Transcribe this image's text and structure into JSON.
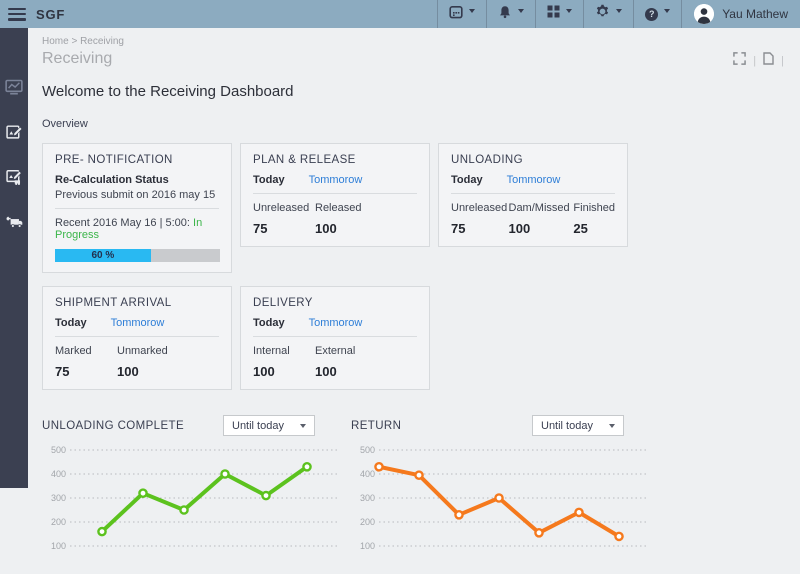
{
  "topbar": {
    "brand": "SGF",
    "user_name": "Yau Mathew",
    "icons": [
      "menu",
      "calendar",
      "notifications",
      "apps",
      "settings",
      "help",
      "user-avatar"
    ],
    "help_glyph": "?"
  },
  "page": {
    "breadcrumb": "Home > Receiving",
    "title": "Receiving",
    "welcome": "Welcome to the Receiving Dashboard",
    "section_label": "Overview"
  },
  "sidebar": {
    "items": [
      "dashboard",
      "receiving-edit",
      "receiving-dispatch-edit",
      "inbound-truck"
    ]
  },
  "cards": {
    "pre_notification": {
      "title": "PRE- NOTIFICATION",
      "status_title": "Re-Calculation Status",
      "status_sub": "Previous submit on 2016 may 15",
      "recent_label": "Recent 2016 May 16 | 5:00:",
      "recent_status": "In Progress",
      "progress_pct": 58,
      "progress_label": "60 %"
    },
    "plan_release": {
      "title": "PLAN & RELEASE",
      "tab_today": "Today",
      "tab_tomorrow": "Tommorow",
      "stats": [
        {
          "label": "Unreleased",
          "value": "75"
        },
        {
          "label": "Released",
          "value": "100"
        }
      ]
    },
    "unloading": {
      "title": "UNLOADING",
      "tab_today": "Today",
      "tab_tomorrow": "Tommorow",
      "stats": [
        {
          "label": "Unreleased",
          "value": "75"
        },
        {
          "label": "Dam/Missed",
          "value": "100"
        },
        {
          "label": "Finished",
          "value": "25"
        }
      ]
    },
    "shipment_arrival": {
      "title": "SHIPMENT ARRIVAL",
      "tab_today": "Today",
      "tab_tomorrow": "Tommorow",
      "stats": [
        {
          "label": "Marked",
          "value": "75"
        },
        {
          "label": "Unmarked",
          "value": "100"
        }
      ]
    },
    "delivery": {
      "title": "DELIVERY",
      "tab_today": "Today",
      "tab_tomorrow": "Tommorow",
      "stats": [
        {
          "label": "Internal",
          "value": "100"
        },
        {
          "label": "External",
          "value": "100"
        }
      ]
    }
  },
  "chart_data": [
    {
      "type": "line",
      "title": "UNLOADING COMPLETE",
      "filter_label": "Until today",
      "ylim": [
        100,
        500
      ],
      "yticks": [
        500,
        400,
        300,
        200,
        100
      ],
      "grid": "dotted-horizontal",
      "legend": "none",
      "x_start": 60,
      "x_step": 41,
      "series": [
        {
          "name": "Unloading Complete",
          "color": "#5cc21e",
          "marker": "open-circle",
          "values": [
            160,
            320,
            250,
            400,
            310,
            430
          ]
        }
      ]
    },
    {
      "type": "line",
      "title": "RETURN",
      "filter_label": "Until today",
      "ylim": [
        100,
        500
      ],
      "yticks": [
        500,
        400,
        300,
        200,
        100
      ],
      "grid": "dotted-horizontal",
      "legend": "none",
      "x_start": 28,
      "x_step": 40,
      "series": [
        {
          "name": "Return",
          "color": "#f5791d",
          "marker": "open-circle",
          "values": [
            430,
            395,
            230,
            300,
            155,
            240,
            140
          ]
        }
      ]
    }
  ],
  "colors": {
    "topbar_bg": "#8cabc0",
    "sidebar_bg": "#3b4051",
    "link_blue": "#2e7ed7",
    "status_green": "#3bb54a",
    "progress_blue": "#29b9f2",
    "chart_green": "#5cc21e",
    "chart_orange": "#f5791d"
  }
}
